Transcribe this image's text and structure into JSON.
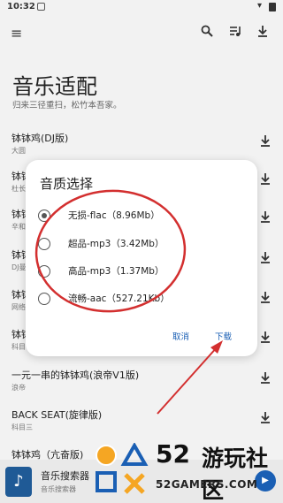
{
  "status": {
    "time": "10:32"
  },
  "app": {
    "title": "音乐适配",
    "subtitle": "归来三径重扫，松竹本吾家。"
  },
  "songs": [
    {
      "title": "钵钵鸡(DJ版)",
      "artist": "大圆"
    },
    {
      "title": "钵钵鸡",
      "artist": "杜长"
    },
    {
      "title": "钵钵鸡",
      "artist": "辛和"
    },
    {
      "title": "钵钵鸡",
      "artist": "DJ曼"
    },
    {
      "title": "钵钵鸡",
      "artist": "网络"
    },
    {
      "title": "钵钵鸡",
      "artist": "科目"
    },
    {
      "title": "一元一串的钵钵鸡(浪帝V1版)",
      "artist": "浪帝"
    },
    {
      "title": "BACK SEAT(旋律版)",
      "artist": "科目三"
    },
    {
      "title": "钵钵鸡（亢奋版)",
      "artist": ""
    }
  ],
  "dialog": {
    "title": "音质选择",
    "options": [
      {
        "label": "无损-flac（8.96Mb）",
        "selected": true
      },
      {
        "label": "超品-mp3（3.42Mb）",
        "selected": false
      },
      {
        "label": "高品-mp3（1.37Mb）",
        "selected": false
      },
      {
        "label": "流畅-aac（527.21Kb）",
        "selected": false
      }
    ],
    "cancel_label": "取消",
    "confirm_label": "下载"
  },
  "player": {
    "title": "音乐搜索器",
    "subtitle": "音乐搜索器"
  },
  "watermark": {
    "number": "52",
    "text": "游玩社区",
    "domain": "52GAMERS.COM"
  },
  "colors": {
    "accent": "#1a5fb4",
    "annotation": "#d32f2f"
  }
}
